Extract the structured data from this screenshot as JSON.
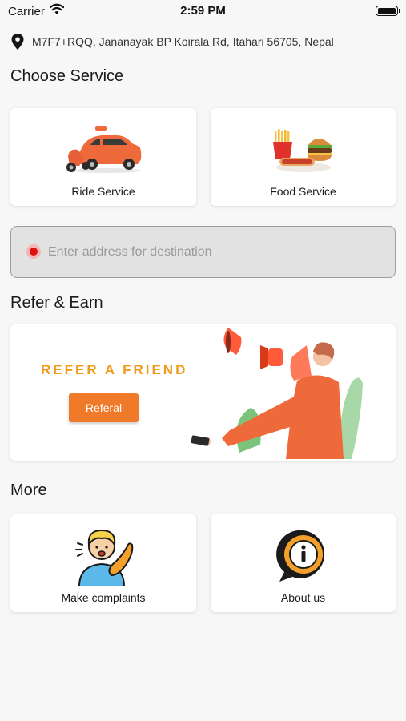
{
  "status_bar": {
    "carrier": "Carrier",
    "time": "2:59 PM",
    "battery_level": 1.0
  },
  "location": {
    "address": "M7F7+RQQ, Jananayak BP Koirala Rd, Itahari 56705, Nepal"
  },
  "choose_service": {
    "title": "Choose Service",
    "cards": [
      {
        "label": "Ride Service",
        "icon": "ride-service-illustration"
      },
      {
        "label": "Food Service",
        "icon": "food-service-illustration"
      }
    ]
  },
  "destination": {
    "placeholder": "Enter address for destination",
    "value": ""
  },
  "refer": {
    "title": "Refer & Earn",
    "heading": "REFER A FRIEND",
    "button_label": "Referal"
  },
  "more": {
    "title": "More",
    "cards": [
      {
        "label": "Make complaints",
        "icon": "complaint-illustration"
      },
      {
        "label": "About us",
        "icon": "info-icon"
      }
    ]
  },
  "colors": {
    "accent_orange": "#ee7a2a",
    "refer_heading": "#f19a1a",
    "destination_dot": "#e01010",
    "background": "#f7f7f7"
  }
}
